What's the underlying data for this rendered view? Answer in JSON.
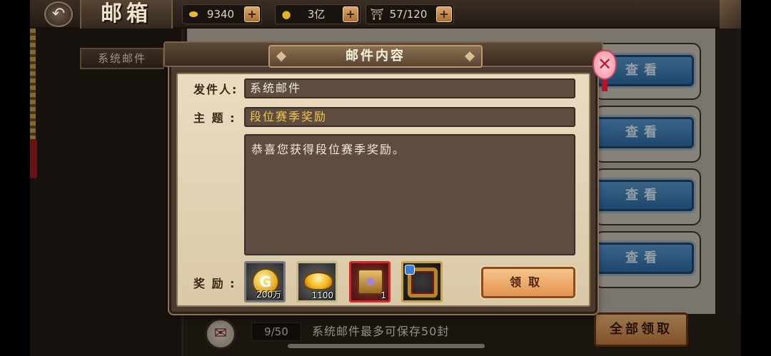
{
  "header": {
    "back_icon": "back-arrow-icon",
    "title": "邮箱",
    "resources": [
      {
        "icon": "gold-ingot-icon",
        "value": "9340"
      },
      {
        "icon": "coin-icon",
        "value": "3亿"
      },
      {
        "icon": "stamina-icon",
        "value": "57/120"
      }
    ],
    "plus_label": "+"
  },
  "sidebar": {
    "active_tab": "系统邮件"
  },
  "mail_list": {
    "view_label": "查看",
    "rows": 4
  },
  "footer": {
    "count": "9/50",
    "note": "系统邮件最多可保存50封",
    "claim_all_label": "全部领取"
  },
  "modal": {
    "title": "邮件内容",
    "sender_label": "发件人:",
    "sender_value": "系统邮件",
    "subject_label": "主  题 :",
    "subject_value": "段位赛季奖励",
    "content": "恭喜您获得段位赛季奖励。",
    "rewards_label": "奖  励 :",
    "rewards": [
      {
        "name": "coin",
        "icon": "g-coin-icon",
        "qty": "200万"
      },
      {
        "name": "gold-ingot",
        "icon": "gold-ingot-icon",
        "qty": "1100"
      },
      {
        "name": "treasure-chest",
        "icon": "chest-icon",
        "qty": "1"
      },
      {
        "name": "avatar-frame",
        "icon": "avatar-frame-icon",
        "qty": ""
      }
    ],
    "claim_label": "领取",
    "close_icon": "close-icon"
  },
  "colors": {
    "subject_text": "#f3c54a",
    "view_button": "#3f80bd",
    "claim_button": "#e9a364"
  }
}
